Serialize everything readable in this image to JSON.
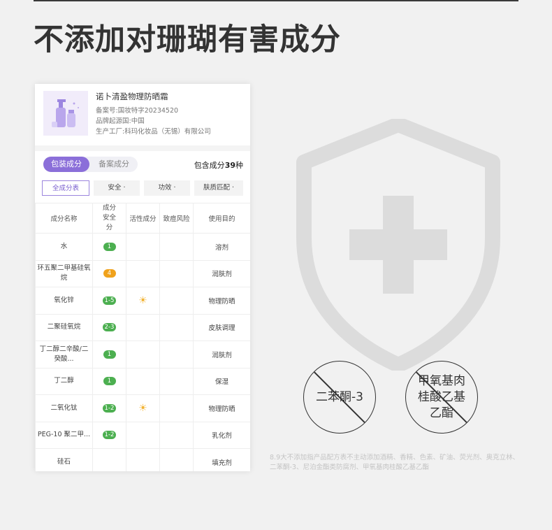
{
  "headline": "不添加对珊瑚有害成分",
  "product": {
    "name": "诺卜清盈物理防晒霜",
    "record": "备案号:国妆特字20234520",
    "origin": "品牌起源国:中国",
    "factory": "生产工厂:科玛化妆品（无锡）有限公司",
    "image_icon": "cosmetic-bottles-icon"
  },
  "tabs": [
    {
      "label": "包装成分",
      "active": true
    },
    {
      "label": "备案成分",
      "active": false
    }
  ],
  "total": {
    "prefix": "包含成分",
    "count": "39",
    "suffix": "种"
  },
  "filters": [
    {
      "label": "全成分表",
      "active": true
    },
    {
      "label": "安全 ·",
      "active": false
    },
    {
      "label": "功效 ·",
      "active": false
    },
    {
      "label": "肤质匹配 ·",
      "active": false
    }
  ],
  "table": {
    "headers": [
      "成分名称",
      "成分安全分",
      "活性成分",
      "致痘风险",
      "使用目的"
    ],
    "rows": [
      {
        "name": "水",
        "score": "1",
        "color": "green",
        "active": false,
        "purpose": "溶剂"
      },
      {
        "name": "环五聚二甲基硅氧烷",
        "score": "4",
        "color": "orange",
        "active": false,
        "purpose": "润肤剂"
      },
      {
        "name": "氧化锌",
        "score": "1-5",
        "color": "green",
        "active": true,
        "purpose": "物理防晒"
      },
      {
        "name": "二聚硅氧烷",
        "score": "2-3",
        "color": "green",
        "active": false,
        "purpose": "皮肤调理"
      },
      {
        "name": "丁二醇二辛酸/二癸酸...",
        "score": "1",
        "color": "green",
        "active": false,
        "purpose": "润肤剂"
      },
      {
        "name": "丁二醇",
        "score": "1",
        "color": "green",
        "active": false,
        "purpose": "保湿"
      },
      {
        "name": "二氧化钛",
        "score": "1-2",
        "color": "green",
        "active": true,
        "purpose": "物理防晒"
      },
      {
        "name": "PEG-10 聚二甲...",
        "score": "1-2",
        "color": "green",
        "active": false,
        "purpose": "乳化剂"
      },
      {
        "name": "硅石",
        "score": "",
        "color": "green",
        "active": false,
        "purpose": "填充剂"
      }
    ]
  },
  "no_add": [
    {
      "text": "二苯酮-3"
    },
    {
      "text": "甲氧基肉桂酸乙基乙酯"
    }
  ],
  "note": "8.9大不添加指产品配方表不主动添加酒精、香精、色素、矿油、荧光剂、奥克立林、二苯酮-3、尼泊金酯类防腐剂、甲氧基肉桂酸乙基乙酯",
  "colors": {
    "accent": "#8b6fd9",
    "safe": "#4caf50",
    "warn": "#f0a21c",
    "shield": "#dcdcdc"
  }
}
